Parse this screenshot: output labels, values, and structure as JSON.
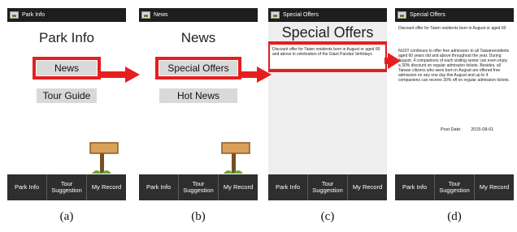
{
  "colors": {
    "highlight": "#e61e1e",
    "titlebar": "#1e1e1e",
    "nav": "#2e2e2e",
    "button": "#d9d9d9"
  },
  "nav": {
    "item1": "Park Info",
    "item2": "Tour\nSuggestion",
    "item3": "My Record"
  },
  "panels": {
    "a": {
      "window_title": "Park Info",
      "heading": "Park Info",
      "buttons": [
        "News",
        "Tour Guide"
      ],
      "caption": "(a)"
    },
    "b": {
      "window_title": "News",
      "heading": "News",
      "buttons": [
        "Special Offers",
        "Hot News"
      ],
      "caption": "(b)"
    },
    "c": {
      "window_title": "Special Offers",
      "heading": "Special Offers",
      "offer_text": "Discount offer for Taiwn residents born in August or aged 60 and above in celebration of the Giant Pandas' birthdays",
      "caption": "(c)"
    },
    "d": {
      "window_title": "Special Offers",
      "summary": "Discount offer for Taiwn residents born in August or aged 60",
      "body": "NUST continues to offer free admission to all Taiwanresidents aged 60 years old and above throughout the year. During August, 4 companions of each visiting senior can even enjoy a 30% discount on regular admission tickets. Besides, all Taiwan citizens who were born in August are offered free admission on any one day this August and up to 4 companions can receive 30% off on regular admission tickets.",
      "post_date_label": "Post Date:",
      "post_date": "2015-08-01",
      "caption": "(d)"
    }
  }
}
